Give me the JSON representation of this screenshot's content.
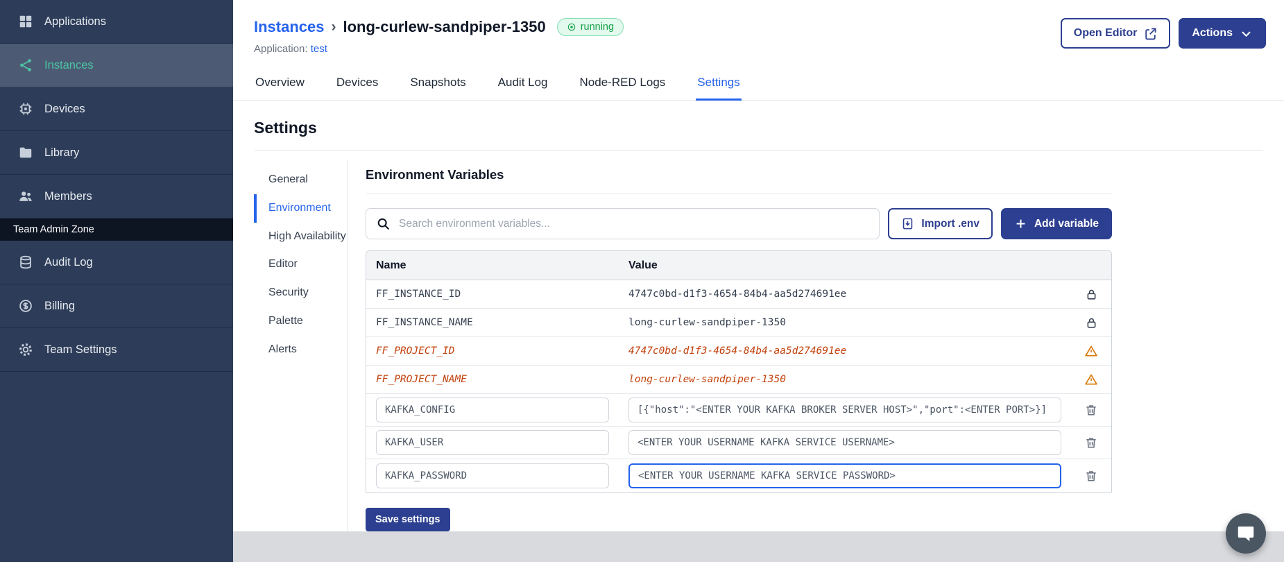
{
  "colors": {
    "sidebar_bg": "#2d3d59",
    "sidebar_active_teal": "#4cc3a5",
    "accent_blue": "#2563eb",
    "brand_navy": "#2c3f90",
    "status_green": "#16a34a",
    "deprecated_orange": "#c2410c",
    "footer_gray": "#d8dade"
  },
  "icons": {
    "sidebar": [
      "applications-icon",
      "instances-icon",
      "devices-icon",
      "library-icon",
      "members-icon",
      "audit-log-icon",
      "billing-icon",
      "team-settings-icon"
    ],
    "misc": [
      "running-icon",
      "external-link-icon",
      "chevron-down-icon",
      "search-icon",
      "import-icon",
      "plus-icon",
      "lock-icon",
      "warning-icon",
      "trash-icon",
      "chat-icon"
    ]
  },
  "sidebar": {
    "items": [
      {
        "label": "Applications"
      },
      {
        "label": "Instances"
      },
      {
        "label": "Devices"
      },
      {
        "label": "Library"
      },
      {
        "label": "Members"
      }
    ],
    "section_label": "Team Admin Zone",
    "admin_items": [
      {
        "label": "Audit Log"
      },
      {
        "label": "Billing"
      },
      {
        "label": "Team Settings"
      }
    ]
  },
  "header": {
    "breadcrumb": "Instances",
    "separator": "›",
    "instance_name": "long-curlew-sandpiper-1350",
    "status": "running",
    "application_label": "Application:",
    "application_name": "test",
    "open_editor_label": "Open Editor",
    "actions_label": "Actions"
  },
  "tabs": [
    {
      "label": "Overview"
    },
    {
      "label": "Devices"
    },
    {
      "label": "Snapshots"
    },
    {
      "label": "Audit Log"
    },
    {
      "label": "Node-RED Logs"
    },
    {
      "label": "Settings"
    }
  ],
  "settings": {
    "title": "Settings",
    "nav": [
      {
        "label": "General"
      },
      {
        "label": "Environment"
      },
      {
        "label": "High Availability"
      },
      {
        "label": "Editor"
      },
      {
        "label": "Security"
      },
      {
        "label": "Palette"
      },
      {
        "label": "Alerts"
      }
    ],
    "section_title": "Environment Variables",
    "search_placeholder": "Search environment variables...",
    "import_label": "Import .env",
    "add_label": "Add variable",
    "save_label": "Save settings",
    "table": {
      "name_header": "Name",
      "value_header": "Value",
      "rows": [
        {
          "name": "FF_INSTANCE_ID",
          "value": "4747c0bd-d1f3-4654-84b4-aa5d274691ee",
          "type": "locked"
        },
        {
          "name": "FF_INSTANCE_NAME",
          "value": "long-curlew-sandpiper-1350",
          "type": "locked"
        },
        {
          "name": "FF_PROJECT_ID",
          "value": "4747c0bd-d1f3-4654-84b4-aa5d274691ee",
          "type": "deprecated"
        },
        {
          "name": "FF_PROJECT_NAME",
          "value": "long-curlew-sandpiper-1350",
          "type": "deprecated"
        },
        {
          "name": "KAFKA_CONFIG",
          "value": "[{\"host\":\"<ENTER YOUR KAFKA BROKER SERVER HOST>\",\"port\":<ENTER PORT>}]",
          "type": "editable"
        },
        {
          "name": "KAFKA_USER",
          "value": "<ENTER YOUR USERNAME KAFKA SERVICE USERNAME>",
          "type": "editable"
        },
        {
          "name": "KAFKA_PASSWORD",
          "value": "<ENTER YOUR USERNAME KAFKA SERVICE PASSWORD>",
          "type": "editable",
          "focused": true
        }
      ]
    }
  }
}
